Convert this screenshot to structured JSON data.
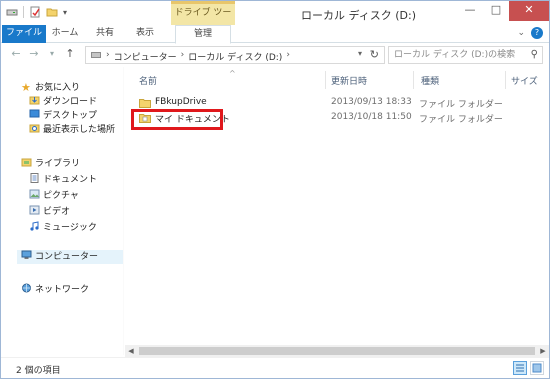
{
  "title": {
    "window_title": "ローカル ディスク (D:)",
    "context_group": "ドライブ ツール"
  },
  "ribbon": {
    "tabs": [
      {
        "label": "ファイル",
        "active_style": "file"
      },
      {
        "label": "ホーム"
      },
      {
        "label": "共有"
      },
      {
        "label": "表示"
      },
      {
        "label": "管理"
      }
    ]
  },
  "address": {
    "crumbs": [
      "コンピューター",
      "ローカル ディスク (D:)"
    ]
  },
  "search": {
    "placeholder": "ローカル ディスク (D:)の検索"
  },
  "navpane": {
    "favorites_label": "お気に入り",
    "favorites": [
      "ダウンロード",
      "デスクトップ",
      "最近表示した場所"
    ],
    "libraries_label": "ライブラリ",
    "libraries": [
      "ドキュメント",
      "ピクチャ",
      "ビデオ",
      "ミュージック"
    ],
    "computer_label": "コンピューター",
    "network_label": "ネットワーク"
  },
  "columns": {
    "name": "名前",
    "date": "更新日時",
    "type": "種類",
    "size": "サイズ"
  },
  "files": [
    {
      "name": "FBkupDrive",
      "date": "2013/09/13 18:33",
      "type": "ファイル フォルダー"
    },
    {
      "name": "マイ ドキュメント",
      "date": "2013/10/18 11:50",
      "type": "ファイル フォルダー"
    }
  ],
  "status": {
    "item_count": "2 個の項目"
  },
  "colors": {
    "file_tab": "#1979ca",
    "context_tab": "#f3e6a6",
    "highlight_box": "#e0181c",
    "selected_nav": "#e5f3fb"
  }
}
